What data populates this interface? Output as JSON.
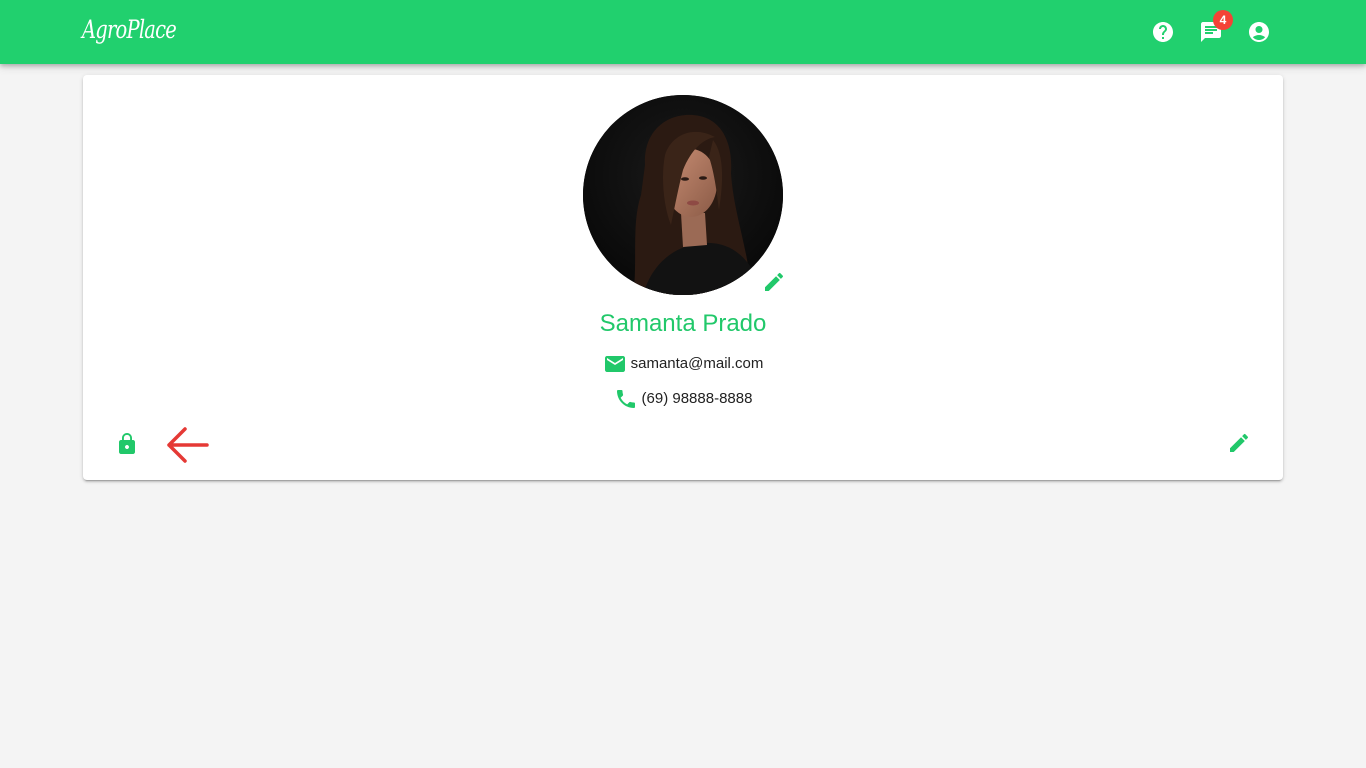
{
  "appbar": {
    "logo_text": "AgroPlace",
    "background_color": "#21d06e",
    "icons": {
      "help": "help-circle-icon",
      "messages": "chat-message-icon",
      "account": "account-circle-icon"
    },
    "messages_badge_count": "4",
    "badge_color": "#f44336"
  },
  "profile": {
    "name": "Samanta Prado",
    "email": "samanta@mail.com",
    "phone": "(69) 98888-8888",
    "accent_color": "#21c86a",
    "icons": {
      "edit_photo": "pencil-icon",
      "email": "email-icon",
      "phone": "phone-icon",
      "change_password": "lock-icon",
      "back": "arrow-left-icon",
      "edit_profile": "pencil-icon"
    },
    "back_arrow_color": "#e53935"
  }
}
